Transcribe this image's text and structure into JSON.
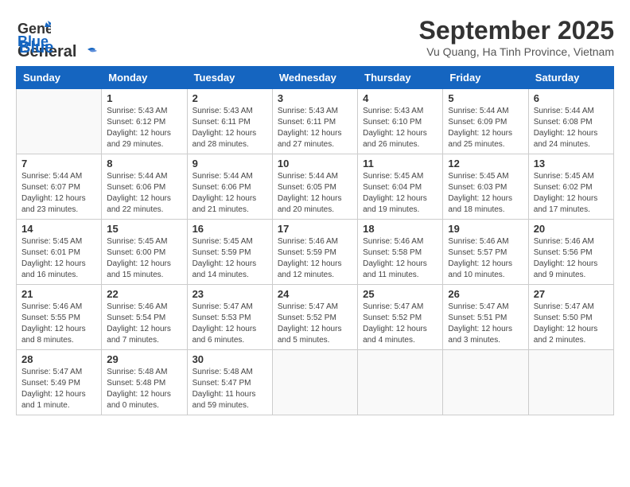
{
  "header": {
    "logo_line1": "General",
    "logo_line2": "Blue",
    "month": "September 2025",
    "location": "Vu Quang, Ha Tinh Province, Vietnam"
  },
  "weekdays": [
    "Sunday",
    "Monday",
    "Tuesday",
    "Wednesday",
    "Thursday",
    "Friday",
    "Saturday"
  ],
  "weeks": [
    [
      {
        "day": "",
        "content": ""
      },
      {
        "day": "1",
        "content": "Sunrise: 5:43 AM\nSunset: 6:12 PM\nDaylight: 12 hours\nand 29 minutes."
      },
      {
        "day": "2",
        "content": "Sunrise: 5:43 AM\nSunset: 6:11 PM\nDaylight: 12 hours\nand 28 minutes."
      },
      {
        "day": "3",
        "content": "Sunrise: 5:43 AM\nSunset: 6:11 PM\nDaylight: 12 hours\nand 27 minutes."
      },
      {
        "day": "4",
        "content": "Sunrise: 5:43 AM\nSunset: 6:10 PM\nDaylight: 12 hours\nand 26 minutes."
      },
      {
        "day": "5",
        "content": "Sunrise: 5:44 AM\nSunset: 6:09 PM\nDaylight: 12 hours\nand 25 minutes."
      },
      {
        "day": "6",
        "content": "Sunrise: 5:44 AM\nSunset: 6:08 PM\nDaylight: 12 hours\nand 24 minutes."
      }
    ],
    [
      {
        "day": "7",
        "content": "Sunrise: 5:44 AM\nSunset: 6:07 PM\nDaylight: 12 hours\nand 23 minutes."
      },
      {
        "day": "8",
        "content": "Sunrise: 5:44 AM\nSunset: 6:06 PM\nDaylight: 12 hours\nand 22 minutes."
      },
      {
        "day": "9",
        "content": "Sunrise: 5:44 AM\nSunset: 6:06 PM\nDaylight: 12 hours\nand 21 minutes."
      },
      {
        "day": "10",
        "content": "Sunrise: 5:44 AM\nSunset: 6:05 PM\nDaylight: 12 hours\nand 20 minutes."
      },
      {
        "day": "11",
        "content": "Sunrise: 5:45 AM\nSunset: 6:04 PM\nDaylight: 12 hours\nand 19 minutes."
      },
      {
        "day": "12",
        "content": "Sunrise: 5:45 AM\nSunset: 6:03 PM\nDaylight: 12 hours\nand 18 minutes."
      },
      {
        "day": "13",
        "content": "Sunrise: 5:45 AM\nSunset: 6:02 PM\nDaylight: 12 hours\nand 17 minutes."
      }
    ],
    [
      {
        "day": "14",
        "content": "Sunrise: 5:45 AM\nSunset: 6:01 PM\nDaylight: 12 hours\nand 16 minutes."
      },
      {
        "day": "15",
        "content": "Sunrise: 5:45 AM\nSunset: 6:00 PM\nDaylight: 12 hours\nand 15 minutes."
      },
      {
        "day": "16",
        "content": "Sunrise: 5:45 AM\nSunset: 5:59 PM\nDaylight: 12 hours\nand 14 minutes."
      },
      {
        "day": "17",
        "content": "Sunrise: 5:46 AM\nSunset: 5:59 PM\nDaylight: 12 hours\nand 12 minutes."
      },
      {
        "day": "18",
        "content": "Sunrise: 5:46 AM\nSunset: 5:58 PM\nDaylight: 12 hours\nand 11 minutes."
      },
      {
        "day": "19",
        "content": "Sunrise: 5:46 AM\nSunset: 5:57 PM\nDaylight: 12 hours\nand 10 minutes."
      },
      {
        "day": "20",
        "content": "Sunrise: 5:46 AM\nSunset: 5:56 PM\nDaylight: 12 hours\nand 9 minutes."
      }
    ],
    [
      {
        "day": "21",
        "content": "Sunrise: 5:46 AM\nSunset: 5:55 PM\nDaylight: 12 hours\nand 8 minutes."
      },
      {
        "day": "22",
        "content": "Sunrise: 5:46 AM\nSunset: 5:54 PM\nDaylight: 12 hours\nand 7 minutes."
      },
      {
        "day": "23",
        "content": "Sunrise: 5:47 AM\nSunset: 5:53 PM\nDaylight: 12 hours\nand 6 minutes."
      },
      {
        "day": "24",
        "content": "Sunrise: 5:47 AM\nSunset: 5:52 PM\nDaylight: 12 hours\nand 5 minutes."
      },
      {
        "day": "25",
        "content": "Sunrise: 5:47 AM\nSunset: 5:52 PM\nDaylight: 12 hours\nand 4 minutes."
      },
      {
        "day": "26",
        "content": "Sunrise: 5:47 AM\nSunset: 5:51 PM\nDaylight: 12 hours\nand 3 minutes."
      },
      {
        "day": "27",
        "content": "Sunrise: 5:47 AM\nSunset: 5:50 PM\nDaylight: 12 hours\nand 2 minutes."
      }
    ],
    [
      {
        "day": "28",
        "content": "Sunrise: 5:47 AM\nSunset: 5:49 PM\nDaylight: 12 hours\nand 1 minute."
      },
      {
        "day": "29",
        "content": "Sunrise: 5:48 AM\nSunset: 5:48 PM\nDaylight: 12 hours\nand 0 minutes."
      },
      {
        "day": "30",
        "content": "Sunrise: 5:48 AM\nSunset: 5:47 PM\nDaylight: 11 hours\nand 59 minutes."
      },
      {
        "day": "",
        "content": ""
      },
      {
        "day": "",
        "content": ""
      },
      {
        "day": "",
        "content": ""
      },
      {
        "day": "",
        "content": ""
      }
    ]
  ]
}
